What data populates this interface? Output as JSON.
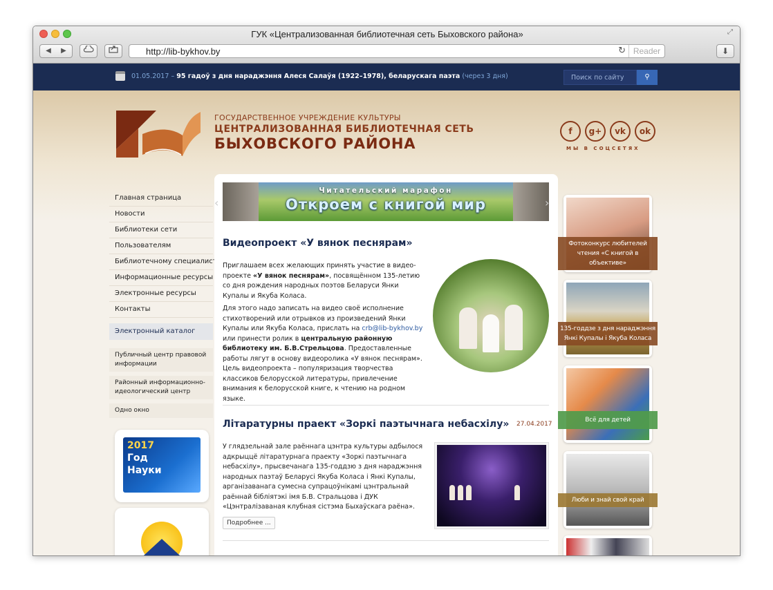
{
  "window": {
    "title": "ГУК «Централизованная библиотечная сеть Быховского района»",
    "url": "http://lib-bykhov.by",
    "reader_label": "Reader"
  },
  "topbar": {
    "date": "01.05.2017",
    "dash": "–",
    "event": "95 гадоў з дня нараджэння Алеся Салаўя (1922–1978), беларускага паэта",
    "countdown": "(через 3 дня)",
    "search_placeholder": "Поиск по сайту"
  },
  "header": {
    "line1": "ГОСУДАРСТВЕННОЕ УЧРЕЖДЕНИЕ КУЛЬТУРЫ",
    "line2": "ЦЕНТРАЛИЗОВАННАЯ БИБЛИОТЕЧНАЯ СЕТЬ",
    "line3": "БЫХОВСКОГО РАЙОНА",
    "social_caption": "МЫ В СОЦСЕТЯХ",
    "social": [
      "f",
      "g+",
      "vk",
      "ok"
    ]
  },
  "menu": [
    "Главная страница",
    "Новости",
    "Библиотеки сети",
    "Пользователям",
    "Библиотечному специалисту",
    "Информационные ресурсы",
    "Электронные ресурсы",
    "Контакты"
  ],
  "catalog": "Электронный каталог",
  "info_links": [
    "Публичный центр правовой информации",
    "Районный информационно-идеологический центр",
    "Одно окно"
  ],
  "year_card": {
    "year": "2017",
    "line1": "Год",
    "line2": "Науки"
  },
  "banner": {
    "small": "Читательский марафон",
    "big": "Откроем с книгой мир"
  },
  "article1": {
    "title": "Видеопроект «У вянок песнярам»",
    "p1_a": "Приглашаем всех желающих принять участие в видео-проекте ",
    "p1_b": "«У вянок песнярам»",
    "p1_c": ", посвящённом 135-летию со дня рождения народных поэтов Беларуси Янки Купалы и Якуба Коласа.",
    "p2_a": "Для этого надо записать на видео своё исполнение стихотворений или отрывков из произведений Янки Купалы или Якуба Коласа, прислать на ",
    "p2_email": "crb@lib-bykhov.by",
    "p2_b": " или принести ролик в ",
    "p2_c": "центральную районную библиотеку им. Б.В.Стрельцова",
    "p2_d": ". Предоставленные работы лягут в основу видеоролика «У вянок песнярам». Цель видеопроекта – популяризация творчества классиков белорусской литературы, привлечение внимания к белорусской книге, к чтению на родном языке."
  },
  "article2": {
    "title": "Літаратурны праект «Зоркі паэтычнага небасхілу»",
    "date": "27.04.2017",
    "text": "У глядзельнай зале раённага цэнтра культуры адбылося адкрыццё літаратурнага праекту «Зоркі паэтычнага небасхілу», прысвечанага 135-годдзю з дня нараджэння народных паэтаў Беларусі Якуба Коласа і Янкі Купалы, арганізаванага сумесна супрацоўнікамі цэнтральнай раённай бібліятэкі імя Б.В. Стральцова і ДУК «Цэнтралізаваная клубная сістэма Быхаўскага раёна».",
    "more": "Подробнее ..."
  },
  "side_cards": [
    {
      "label": "Фотоконкурс любителей чтения «С книгой в объективе»"
    },
    {
      "label": "135-годдзе з дня нараджэння Янкі Купалы і Якуба Коласа"
    },
    {
      "label": "Всё для детей"
    },
    {
      "label": "Люби и знай свой край"
    }
  ]
}
